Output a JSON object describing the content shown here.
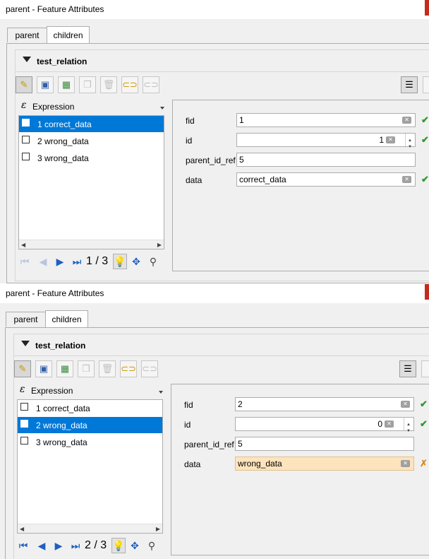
{
  "colors": {
    "selection": "#0078d7",
    "ok": "#2e9a2e",
    "warn": "#e0861a",
    "warn_field": "#fde4bc"
  },
  "icons": {
    "edit": "pencil-icon",
    "save": "save-icon",
    "add": "add-feature-icon",
    "duplicate": "duplicate-icon",
    "delete": "delete-icon",
    "link": "link-icon",
    "unlink": "unlink-icon",
    "view": "form-view-icon",
    "first": "first-icon",
    "prev": "prev-icon",
    "next": "next-icon",
    "last": "last-icon",
    "highlight": "lightbulb-icon",
    "pan": "pan-icon",
    "zoom": "zoom-icon",
    "expression": "epsilon-icon",
    "ok": "check-icon",
    "bad": "cross-icon"
  },
  "panels": [
    {
      "window_title": "parent - Feature Attributes",
      "tabs": [
        "parent",
        "children"
      ],
      "group_title": "test_relation",
      "expression_label": "Expression",
      "list_items": [
        "1 correct_data",
        "2 wrong_data",
        "3 wrong_data"
      ],
      "counter": "1 / 3",
      "fields": [
        {
          "label": "fid",
          "value": "1"
        },
        {
          "label": "id",
          "value": "1"
        },
        {
          "label": "parent_id_ref",
          "value": "5"
        },
        {
          "label": "data",
          "value": "correct_data"
        }
      ],
      "status": {
        "ok": "✔",
        "bad": "✘"
      }
    },
    {
      "window_title": "parent - Feature Attributes",
      "tabs": [
        "parent",
        "children"
      ],
      "group_title": "test_relation",
      "expression_label": "Expression",
      "list_items": [
        "1 correct_data",
        "2 wrong_data",
        "3 wrong_data"
      ],
      "counter": "2 / 3",
      "fields": [
        {
          "label": "fid",
          "value": "2"
        },
        {
          "label": "id",
          "value": "0"
        },
        {
          "label": "parent_id_ref",
          "value": "5"
        },
        {
          "label": "data",
          "value": "wrong_data"
        }
      ],
      "status": {
        "ok": "✔",
        "bad": "✗"
      }
    }
  ]
}
